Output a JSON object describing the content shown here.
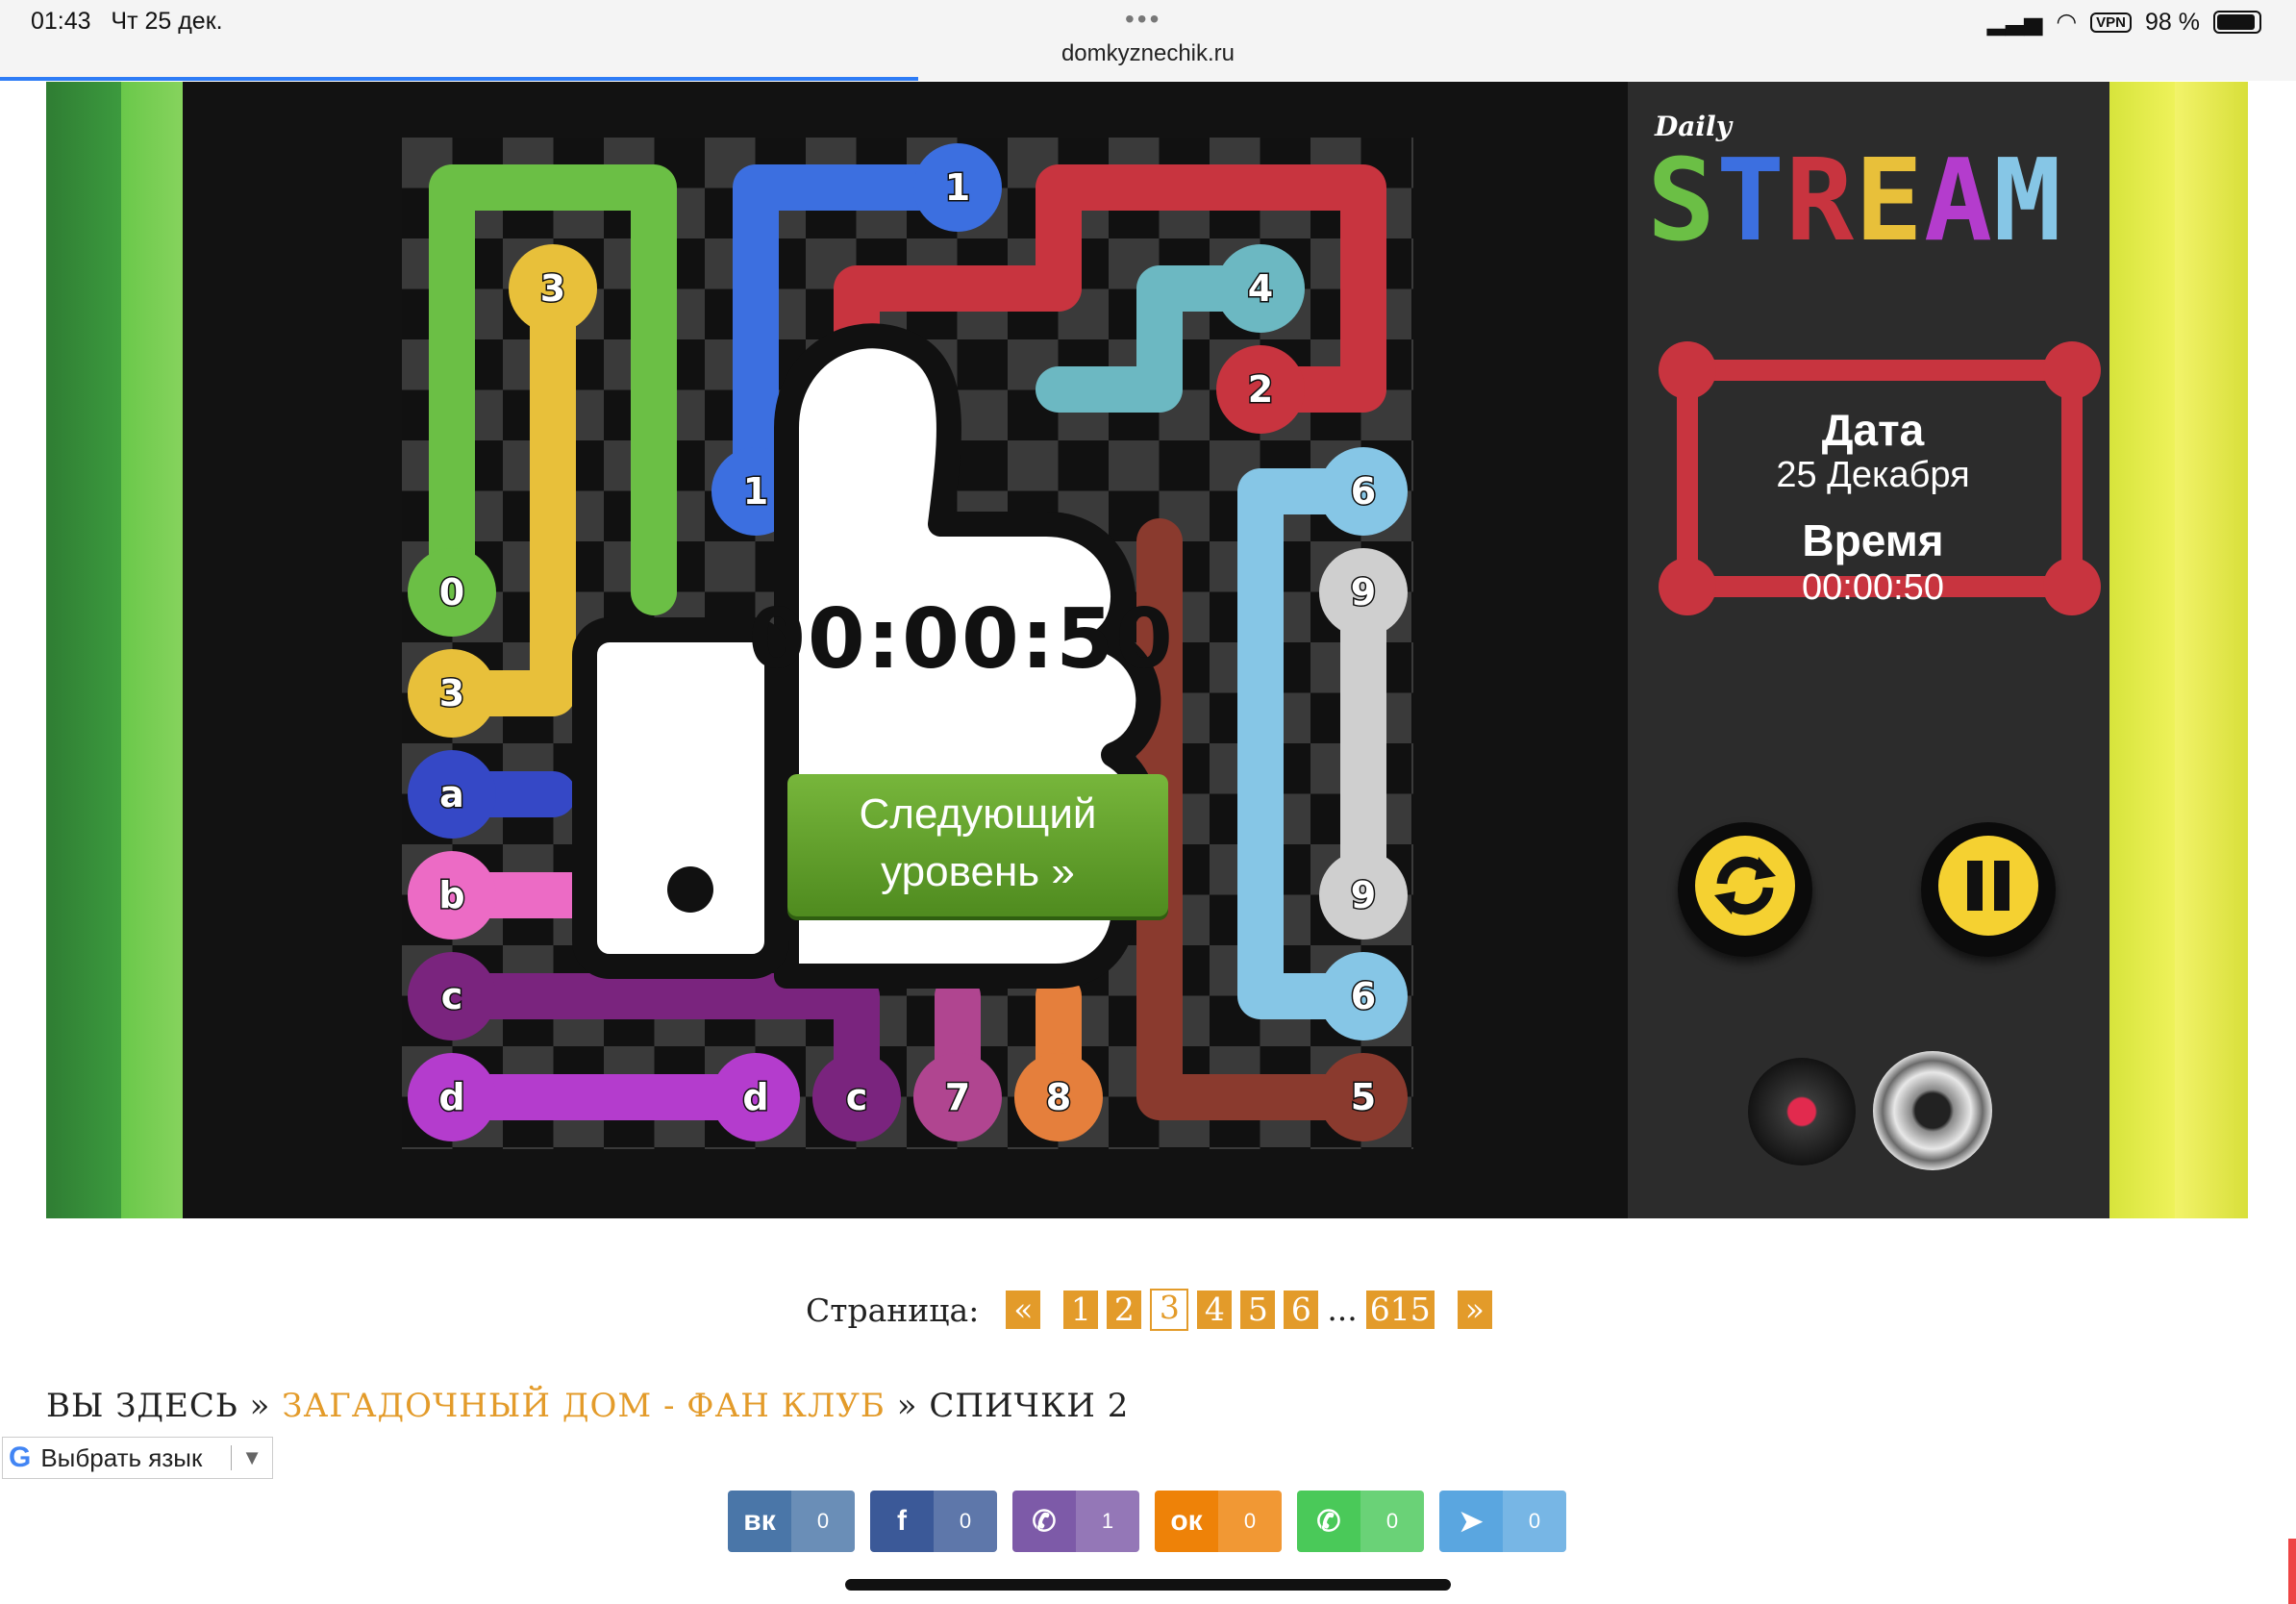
{
  "status_bar": {
    "time": "01:43",
    "date": "Чт 25 дек.",
    "url": "domkyznechik.ru",
    "vpn": "VPN",
    "battery": "98 %"
  },
  "board": {
    "cell_labels": [
      {
        "t": "1",
        "c": "#3c6fe0"
      },
      {
        "t": "1",
        "c": "#3c6fe0"
      },
      {
        "t": "3",
        "c": "#e8c03a"
      },
      {
        "t": "3",
        "c": "#e8c03a"
      },
      {
        "t": "4",
        "c": "#6cb8c2"
      },
      {
        "t": "2",
        "c": "#c8343f"
      },
      {
        "t": "0",
        "c": "#6bbf45"
      },
      {
        "t": "6",
        "c": "#86c6e6"
      },
      {
        "t": "6",
        "c": "#86c6e6"
      },
      {
        "t": "9",
        "c": "#cfcfcf"
      },
      {
        "t": "9",
        "c": "#cfcfcf"
      },
      {
        "t": "a",
        "c": "#3548c6"
      },
      {
        "t": "b",
        "c": "#ec6bc5"
      },
      {
        "t": "b",
        "c": "#ec6bc5"
      },
      {
        "t": "c",
        "c": "#7a247e"
      },
      {
        "t": "c",
        "c": "#7a247e"
      },
      {
        "t": "d",
        "c": "#b43ccd"
      },
      {
        "t": "d",
        "c": "#b43ccd"
      },
      {
        "t": "7",
        "c": "#b04590"
      },
      {
        "t": "8",
        "c": "#e57f3c"
      },
      {
        "t": "5",
        "c": "#8a3a2e"
      }
    ]
  },
  "overlay": {
    "timer": "00:00:50",
    "next_button": [
      "Следующий",
      "уровень »"
    ]
  },
  "panel": {
    "logo_small": "Daily",
    "logo_big": "STREAM",
    "date_label": "Дата",
    "date_value": "25 Декабря",
    "time_label": "Время",
    "time_value": "00:00:50",
    "buttons": [
      "refresh-icon",
      "pause-icon",
      "record-icon",
      "speaker-icon"
    ],
    "accent": "#c8343f"
  },
  "pager": {
    "label": "Страница:",
    "prev": "«",
    "pages": [
      "1",
      "2",
      "3",
      "4",
      "5",
      "6"
    ],
    "current": "3",
    "gap": "...",
    "last": "615",
    "next": "»"
  },
  "breadcrumbs": {
    "here": "ВЫ ЗДЕСЬ",
    "sep": "»",
    "link": "ЗАГАДОЧНЫЙ ДОМ - ФАН КЛУБ",
    "current": "СПИЧКИ 2"
  },
  "translate": {
    "logo": "G",
    "label": "Выбрать язык",
    "arrow": "▼"
  },
  "shares": [
    {
      "name": "vk",
      "label": "вк",
      "count": "0",
      "color": "#4a76a8"
    },
    {
      "name": "facebook",
      "label": "f",
      "count": "0",
      "color": "#3b5998"
    },
    {
      "name": "viber",
      "label": "✆",
      "count": "1",
      "color": "#7d5aa8"
    },
    {
      "name": "odnoklassniki",
      "label": "ок",
      "count": "0",
      "color": "#ee8208"
    },
    {
      "name": "whatsapp",
      "label": "✆",
      "count": "0",
      "color": "#4ac959"
    },
    {
      "name": "telegram",
      "label": "➤",
      "count": "0",
      "color": "#5aa6e0"
    }
  ]
}
